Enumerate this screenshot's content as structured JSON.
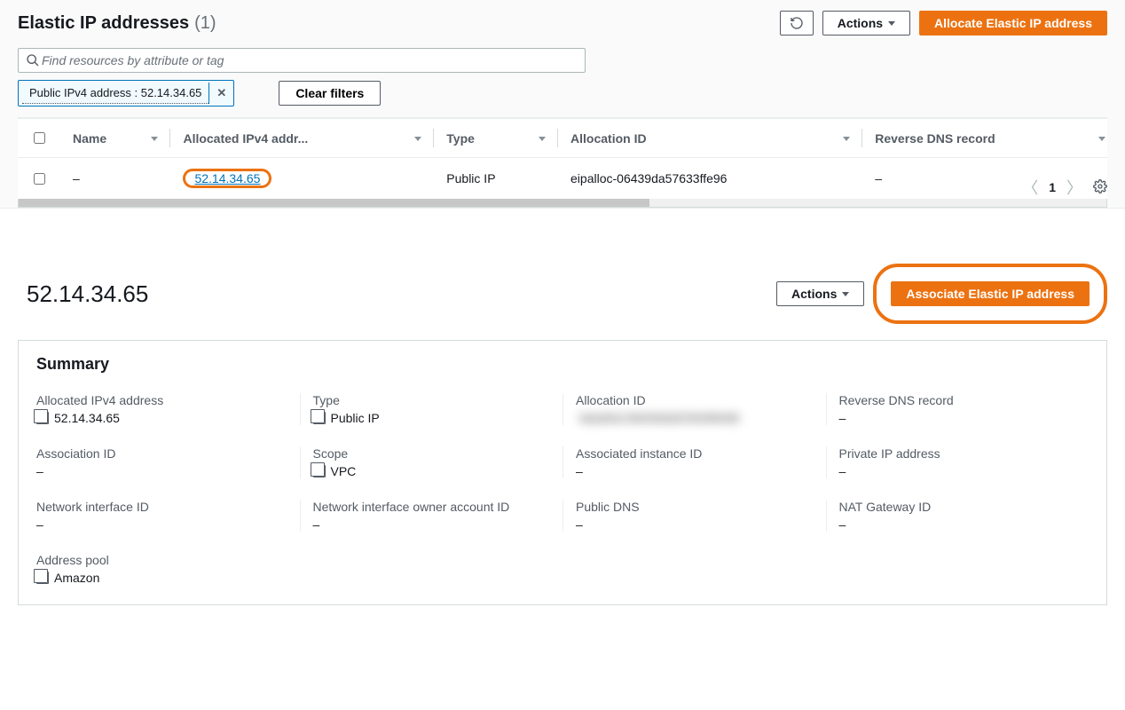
{
  "header": {
    "title": "Elastic IP addresses",
    "count": "(1)",
    "refresh_tooltip": "Refresh",
    "actions_label": "Actions",
    "allocate_label": "Allocate Elastic IP address"
  },
  "search": {
    "placeholder": "Find resources by attribute or tag"
  },
  "filter_token": {
    "label": "Public IPv4 address : 52.14.34.65",
    "remove_title": "Remove filter"
  },
  "clear_filters_label": "Clear filters",
  "pager": {
    "page": "1"
  },
  "columns": {
    "name": "Name",
    "allocated": "Allocated IPv4 addr...",
    "type": "Type",
    "allocation_id": "Allocation ID",
    "reverse_dns": "Reverse DNS record"
  },
  "row": {
    "name": "–",
    "address": "52.14.34.65",
    "type": "Public IP",
    "allocation_id": "eipalloc-06439da57633ffe96",
    "reverse_dns": "–"
  },
  "detail": {
    "title": "52.14.34.65",
    "actions_label": "Actions",
    "associate_label": "Associate Elastic IP address",
    "summary_title": "Summary",
    "fields": {
      "allocated_ipv4": {
        "label": "Allocated IPv4 address",
        "value": "52.14.34.65",
        "copy": true
      },
      "type": {
        "label": "Type",
        "value": "Public IP",
        "copy": true
      },
      "allocation_id": {
        "label": "Allocation ID",
        "value": "eipalloc-06439da57633ffe96",
        "blur": true
      },
      "reverse_dns": {
        "label": "Reverse DNS record",
        "value": "–"
      },
      "association_id": {
        "label": "Association ID",
        "value": "–"
      },
      "scope": {
        "label": "Scope",
        "value": "VPC",
        "copy": true
      },
      "associated_inst": {
        "label": "Associated instance ID",
        "value": "–"
      },
      "private_ip": {
        "label": "Private IP address",
        "value": "–"
      },
      "nif_id": {
        "label": "Network interface ID",
        "value": "–"
      },
      "nif_owner": {
        "label": "Network interface owner account ID",
        "value": "–"
      },
      "public_dns": {
        "label": "Public DNS",
        "value": "–"
      },
      "nat_gw": {
        "label": "NAT Gateway ID",
        "value": "–"
      },
      "addr_pool": {
        "label": "Address pool",
        "value": "Amazon",
        "copy": true
      }
    }
  }
}
